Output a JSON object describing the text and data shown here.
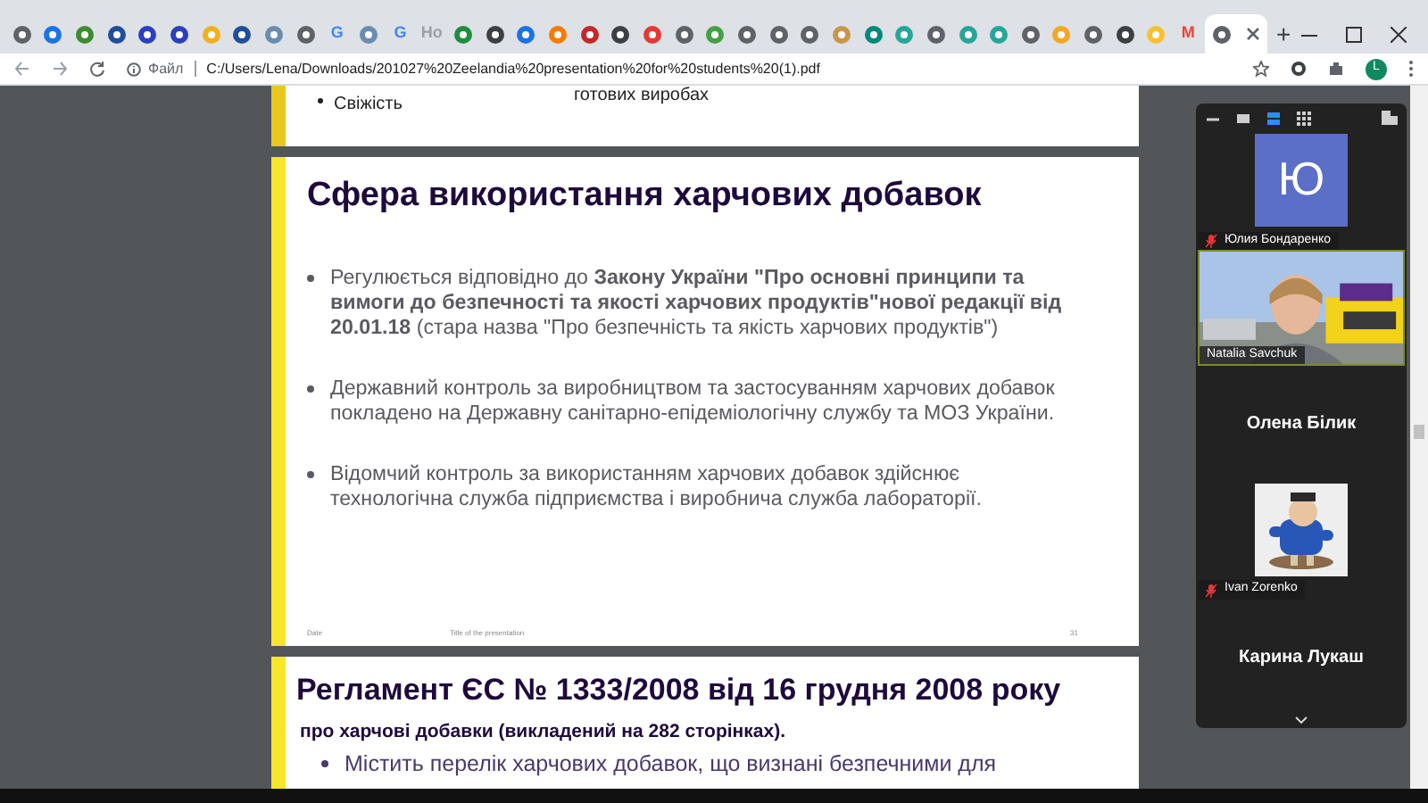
{
  "browser": {
    "tabs": [
      {
        "kind": "icon",
        "color": "#5f6368",
        "selected": false
      },
      {
        "kind": "icon",
        "color": "#1a73e8",
        "selected": false
      },
      {
        "kind": "icon",
        "color": "#3c8d2f",
        "selected": false
      },
      {
        "kind": "icon",
        "color": "#1f4e9c",
        "selected": false
      },
      {
        "kind": "icon",
        "color": "#2b3fbf",
        "selected": false
      },
      {
        "kind": "icon",
        "color": "#2b3fbf",
        "selected": false
      },
      {
        "kind": "icon",
        "color": "#f2b01e",
        "selected": false
      },
      {
        "kind": "icon",
        "color": "#1f4e9c",
        "selected": false
      },
      {
        "kind": "icon",
        "color": "#6a8caf",
        "selected": false
      },
      {
        "kind": "icon",
        "color": "#5f6368",
        "selected": false
      },
      {
        "kind": "text",
        "label": "G",
        "color": "#4285f4",
        "selected": false
      },
      {
        "kind": "icon",
        "color": "#6a8caf",
        "selected": false
      },
      {
        "kind": "text",
        "label": "G",
        "color": "#4285f4",
        "selected": false
      },
      {
        "kind": "text",
        "label": "Ho",
        "color": "#9aa0a6",
        "selected": false
      },
      {
        "kind": "icon",
        "color": "#1e8e3e",
        "selected": false
      },
      {
        "kind": "icon",
        "color": "#3c4043",
        "selected": false
      },
      {
        "kind": "icon",
        "color": "#1a73e8",
        "selected": false
      },
      {
        "kind": "icon",
        "color": "#f57c00",
        "selected": false
      },
      {
        "kind": "icon",
        "color": "#c62828",
        "selected": false
      },
      {
        "kind": "icon",
        "color": "#3c4043",
        "selected": false
      },
      {
        "kind": "icon",
        "color": "#e53935",
        "selected": false
      },
      {
        "kind": "icon",
        "color": "#5f6368",
        "selected": false
      },
      {
        "kind": "icon",
        "color": "#43a047",
        "selected": false
      },
      {
        "kind": "icon",
        "color": "#5f6368",
        "selected": false
      },
      {
        "kind": "icon",
        "color": "#5f6368",
        "selected": false
      },
      {
        "kind": "icon",
        "color": "#5f6368",
        "selected": false
      },
      {
        "kind": "icon",
        "color": "#c8964b",
        "selected": false
      },
      {
        "kind": "icon",
        "color": "#00897b",
        "selected": false
      },
      {
        "kind": "icon",
        "color": "#26a69a",
        "selected": false
      },
      {
        "kind": "icon",
        "color": "#5f6368",
        "selected": false
      },
      {
        "kind": "icon",
        "color": "#26a69a",
        "selected": false
      },
      {
        "kind": "icon",
        "color": "#26a69a",
        "selected": false
      },
      {
        "kind": "icon",
        "color": "#5f6368",
        "selected": false
      },
      {
        "kind": "icon",
        "color": "#f5a623",
        "selected": false
      },
      {
        "kind": "icon",
        "color": "#5f6368",
        "selected": false
      },
      {
        "kind": "icon",
        "color": "#3c4043",
        "selected": false
      },
      {
        "kind": "icon",
        "color": "#fbc02d",
        "selected": false
      },
      {
        "kind": "text",
        "label": "M",
        "color": "#ea4335",
        "selected": false
      },
      {
        "kind": "icon",
        "color": "#5f6368",
        "selected": true
      }
    ],
    "new_tab": "+",
    "address": {
      "scheme_label": "Файл",
      "url": "C:/Users/Lena/Downloads/201027%20Zeelandia%20presentation%20for%20students%20(1).pdf"
    },
    "profile_initial": "L"
  },
  "pdf": {
    "previous_slide": {
      "bullet": "Свіжість",
      "column_2": "готових виробах"
    },
    "slide": {
      "title": "Сфера використання харчових добавок",
      "bullets": [
        "Регулюється відповідно до **Закону України \"Про основні принципи та вимоги до безпечності та якості харчових продуктів\"нової редакції від 20.01.18** (стара назва \"Про безпечність та якість харчових продуктів\")",
        "Державний контроль за виробництвом та застосуванням харчових добавок покладено на Державну санітарно-епідеміологічну службу та МОЗ України.",
        "Відомчий контроль за використанням харчових добавок здійснює технологічна служба підприємства і виробнича служба лабораторії."
      ],
      "footer_date": "Date",
      "footer_title": "Title of the presentation",
      "page_number": "31"
    },
    "next_slide": {
      "title": "Регламент ЄС № 1333/2008 від 16 грудня 2008 року",
      "subtitle": "про харчові добавки (викладений на 282 сторінках).",
      "bullet": "Містить перелік харчових добавок, що визнані безпечними для"
    }
  },
  "zoom_panel": {
    "view_buttons": [
      {
        "selected": false
      },
      {
        "selected": false
      },
      {
        "selected": true
      },
      {
        "selected": false
      }
    ],
    "participants": [
      {
        "kind": "initial",
        "initial": "Ю",
        "name": "Юлия Бондаренко",
        "muted": true
      },
      {
        "kind": "video",
        "name": "Natalia Savchuk",
        "muted": false
      },
      {
        "kind": "name",
        "name": "Олена Білик",
        "muted": false
      },
      {
        "kind": "avatar",
        "name": "Ivan Zorenko",
        "muted": true
      },
      {
        "kind": "name",
        "name": "Карина Лукаш",
        "muted": false
      }
    ]
  }
}
